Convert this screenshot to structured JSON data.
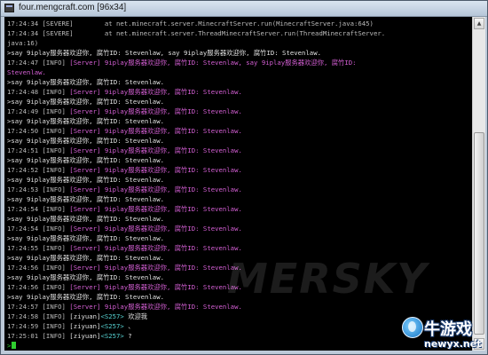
{
  "window": {
    "title": "four.mengcraft.com [96x34]"
  },
  "console": {
    "lines": [
      [
        {
          "t": "17:24:34 [SEVERE]        at net.minecraft.server.MinecraftServer.run(MinecraftServer.java:645)",
          "c": "default"
        }
      ],
      [
        {
          "t": "17:24:34 [SEVERE]        at net.minecraft.server.ThreadMinecraftServer.run(ThreadMinecraftServer.",
          "c": "default"
        }
      ],
      [
        {
          "t": "java:16)",
          "c": "default"
        }
      ],
      [
        {
          "t": ">say 9iplay服务器欢迎你, 腐竹ID: Stevenlaw, say 9iplay服务器欢迎你, 腐竹ID: Stevenlaw.",
          "c": "chat"
        }
      ],
      [
        {
          "t": "17:24:47 [INFO] ",
          "c": "default"
        },
        {
          "t": "[Server] 9iplay服务器欢迎你, 腐竹ID: Stevenlaw, say 9iplay服务器欢迎你, 腐竹ID: ",
          "c": "server"
        }
      ],
      [
        {
          "t": "Stevenlaw.",
          "c": "server"
        }
      ],
      [
        {
          "t": ">say 9iplay服务器欢迎你, 腐竹ID: Stevenlaw.",
          "c": "chat"
        }
      ],
      [
        {
          "t": "17:24:48 [INFO] ",
          "c": "default"
        },
        {
          "t": "[Server] 9iplay服务器欢迎你, 腐竹ID: Stevenlaw.",
          "c": "server"
        }
      ],
      [
        {
          "t": ">say 9iplay服务器欢迎你, 腐竹ID: Stevenlaw.",
          "c": "chat"
        }
      ],
      [
        {
          "t": "17:24:49 [INFO] ",
          "c": "default"
        },
        {
          "t": "[Server] 9iplay服务器欢迎你, 腐竹ID: Stevenlaw.",
          "c": "server"
        }
      ],
      [
        {
          "t": ">say 9iplay服务器欢迎你, 腐竹ID: Stevenlaw.",
          "c": "chat"
        }
      ],
      [
        {
          "t": "17:24:50 [INFO] ",
          "c": "default"
        },
        {
          "t": "[Server] 9iplay服务器欢迎你, 腐竹ID: Stevenlaw.",
          "c": "server"
        }
      ],
      [
        {
          "t": ">say 9iplay服务器欢迎你, 腐竹ID: Stevenlaw.",
          "c": "chat"
        }
      ],
      [
        {
          "t": "17:24:51 [INFO] ",
          "c": "default"
        },
        {
          "t": "[Server] 9iplay服务器欢迎你, 腐竹ID: Stevenlaw.",
          "c": "server"
        }
      ],
      [
        {
          "t": ">say 9iplay服务器欢迎你, 腐竹ID: Stevenlaw.",
          "c": "chat"
        }
      ],
      [
        {
          "t": "17:24:52 [INFO] ",
          "c": "default"
        },
        {
          "t": "[Server] 9iplay服务器欢迎你, 腐竹ID: Stevenlaw.",
          "c": "server"
        }
      ],
      [
        {
          "t": ">say 9iplay服务器欢迎你, 腐竹ID: Stevenlaw.",
          "c": "chat"
        }
      ],
      [
        {
          "t": "17:24:53 [INFO] ",
          "c": "default"
        },
        {
          "t": "[Server] 9iplay服务器欢迎你, 腐竹ID: Stevenlaw.",
          "c": "server"
        }
      ],
      [
        {
          "t": ">say 9iplay服务器欢迎你, 腐竹ID: Stevenlaw.",
          "c": "chat"
        }
      ],
      [
        {
          "t": "17:24:54 [INFO] ",
          "c": "default"
        },
        {
          "t": "[Server] 9iplay服务器欢迎你, 腐竹ID: Stevenlaw.",
          "c": "server"
        }
      ],
      [
        {
          "t": ">say 9iplay服务器欢迎你, 腐竹ID: Stevenlaw.",
          "c": "chat"
        }
      ],
      [
        {
          "t": "17:24:54 [INFO] ",
          "c": "default"
        },
        {
          "t": "[Server] 9iplay服务器欢迎你, 腐竹ID: Stevenlaw.",
          "c": "server"
        }
      ],
      [
        {
          "t": ">say 9iplay服务器欢迎你, 腐竹ID: Stevenlaw.",
          "c": "chat"
        }
      ],
      [
        {
          "t": "17:24:55 [INFO] ",
          "c": "default"
        },
        {
          "t": "[Server] 9iplay服务器欢迎你, 腐竹ID: Stevenlaw.",
          "c": "server"
        }
      ],
      [
        {
          "t": ">say 9iplay服务器欢迎你, 腐竹ID: Stevenlaw.",
          "c": "chat"
        }
      ],
      [
        {
          "t": "17:24:56 [INFO] ",
          "c": "default"
        },
        {
          "t": "[Server] 9iplay服务器欢迎你, 腐竹ID: Stevenlaw.",
          "c": "server"
        }
      ],
      [
        {
          "t": ">say 9iplay服务器欢迎你, 腐竹ID: Stevenlaw.",
          "c": "chat"
        }
      ],
      [
        {
          "t": "17:24:56 [INFO] ",
          "c": "default"
        },
        {
          "t": "[Server] 9iplay服务器欢迎你, 腐竹ID: Stevenlaw.",
          "c": "server"
        }
      ],
      [
        {
          "t": ">say 9iplay服务器欢迎你, 腐竹ID: Stevenlaw.",
          "c": "chat"
        }
      ],
      [
        {
          "t": "17:24:57 [INFO] ",
          "c": "default"
        },
        {
          "t": "[Server] 9iplay服务器欢迎你, 腐竹ID: Stevenlaw.",
          "c": "server"
        }
      ],
      [
        {
          "t": "17:24:58 [INFO] ",
          "c": "default"
        },
        {
          "t": "[ziyuan]",
          "c": "name"
        },
        {
          "t": "<S257>",
          "c": "tag"
        },
        {
          "t": " 欢迎我",
          "c": "chat"
        }
      ],
      [
        {
          "t": "17:24:59 [INFO] ",
          "c": "default"
        },
        {
          "t": "[ziyuan]",
          "c": "name"
        },
        {
          "t": "<S257>",
          "c": "tag"
        },
        {
          "t": " 、",
          "c": "chat"
        }
      ],
      [
        {
          "t": "17:25:01 [INFO] ",
          "c": "default"
        },
        {
          "t": "[ziyuan]",
          "c": "name"
        },
        {
          "t": "<S257>",
          "c": "tag"
        },
        {
          "t": " ?",
          "c": "chat"
        }
      ],
      [
        {
          "t": ">",
          "c": "prompt"
        }
      ]
    ]
  },
  "watermark": "MERSKY",
  "logo": {
    "title": "牛游戏",
    "subtitle": "newyx.net"
  },
  "scroll": {
    "up_glyph": "▲",
    "down_glyph": "▼"
  }
}
